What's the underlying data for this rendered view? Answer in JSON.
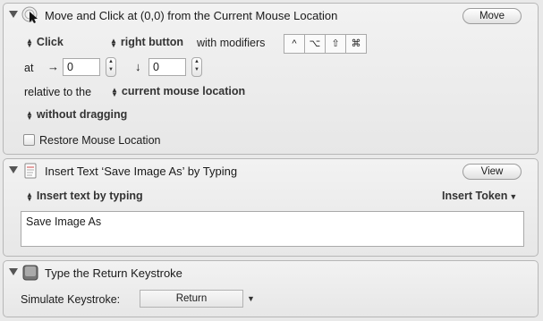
{
  "action1": {
    "title": "Move and Click at (0,0) from the Current Mouse Location",
    "button": "Move",
    "click_type": "Click",
    "mouse_button": "right button",
    "with_modifiers_label": "with modifiers",
    "modifiers": [
      "^",
      "⌥",
      "⇧",
      "⌘"
    ],
    "at_label": "at",
    "x_arrow": "→",
    "x_value": "0",
    "y_arrow": "↓",
    "y_value": "0",
    "relative_label": "relative to the",
    "relative_value": "current mouse location",
    "drag_value": "without dragging",
    "restore_label": "Restore Mouse Location"
  },
  "action2": {
    "title": "Insert Text ‘Save Image As’ by Typing",
    "button": "View",
    "mode": "Insert text by typing",
    "insert_token": "Insert Token",
    "text": "Save Image As"
  },
  "action3": {
    "title": "Type the Return Keystroke",
    "simulate_label": "Simulate Keystroke:",
    "key": "Return"
  }
}
